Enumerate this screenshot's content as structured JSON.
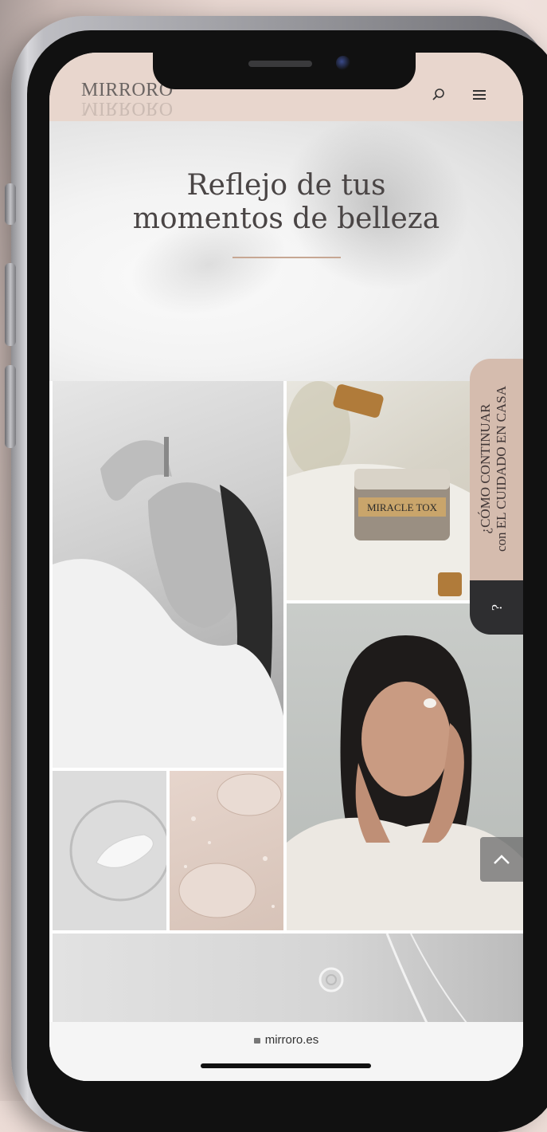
{
  "header": {
    "logo_text": "MIRRORO",
    "search_icon": "search-icon",
    "menu_icon": "hamburger-menu-icon"
  },
  "hero": {
    "title_line1": "Reflejo de tus",
    "title_line2": "momentos de belleza"
  },
  "gallery": {
    "product_label": "MIRACLE TOX"
  },
  "side_tab": {
    "text_line1": "¿CÓMO CONTINUAR",
    "text_line2": "con EL CUIDADO EN CASA",
    "question_mark": "?"
  },
  "browser": {
    "url": "mirroro.es",
    "lock_icon": "lock-icon"
  },
  "colors": {
    "header_bg": "#e8d6cd",
    "accent_line": "#c7a793",
    "side_tab_bg": "#d5bcae",
    "side_question_bg": "#2e2e30"
  }
}
